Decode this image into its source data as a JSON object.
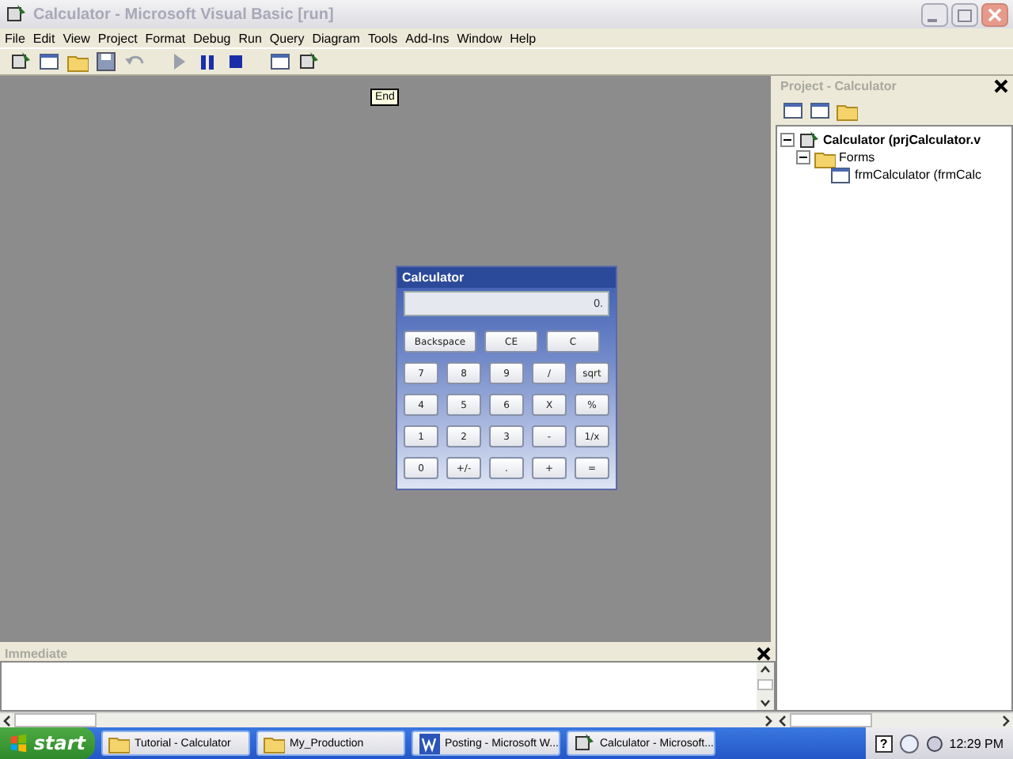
{
  "window": {
    "title": "Calculator - Microsoft Visual Basic [run]"
  },
  "menu": [
    "File",
    "Edit",
    "View",
    "Project",
    "Format",
    "Debug",
    "Run",
    "Query",
    "Diagram",
    "Tools",
    "Add-Ins",
    "Window",
    "Help"
  ],
  "tooltip": "End",
  "form": {
    "title": "Calculator",
    "display": "0.",
    "top_buttons": [
      "Backspace",
      "CE",
      "C"
    ],
    "keys": [
      [
        "7",
        "8",
        "9",
        "/",
        "sqrt"
      ],
      [
        "4",
        "5",
        "6",
        "X",
        "%"
      ],
      [
        "1",
        "2",
        "3",
        "-",
        "1/x"
      ],
      [
        "0",
        "+/-",
        ".",
        "+",
        "="
      ]
    ]
  },
  "project": {
    "title": "Project - Calculator",
    "tree": [
      {
        "label": "Calculator (prjCalculator.v",
        "kind": "project",
        "expanded": true,
        "children": [
          {
            "label": "Forms",
            "kind": "folder",
            "expanded": true,
            "children": [
              {
                "label": "frmCalculator (frmCalc",
                "kind": "form"
              }
            ]
          }
        ]
      }
    ]
  },
  "immediate": {
    "title": "Immediate"
  },
  "taskbar": {
    "start": "start",
    "tasks": [
      {
        "label": "Tutorial - Calculator",
        "kind": "folder"
      },
      {
        "label": "My_Production",
        "kind": "folder"
      },
      {
        "label": "Posting - Microsoft W...",
        "kind": "word"
      },
      {
        "label": "Calculator - Microsoft...",
        "kind": "vb"
      }
    ],
    "help": "?",
    "clock": "12:29 PM"
  }
}
